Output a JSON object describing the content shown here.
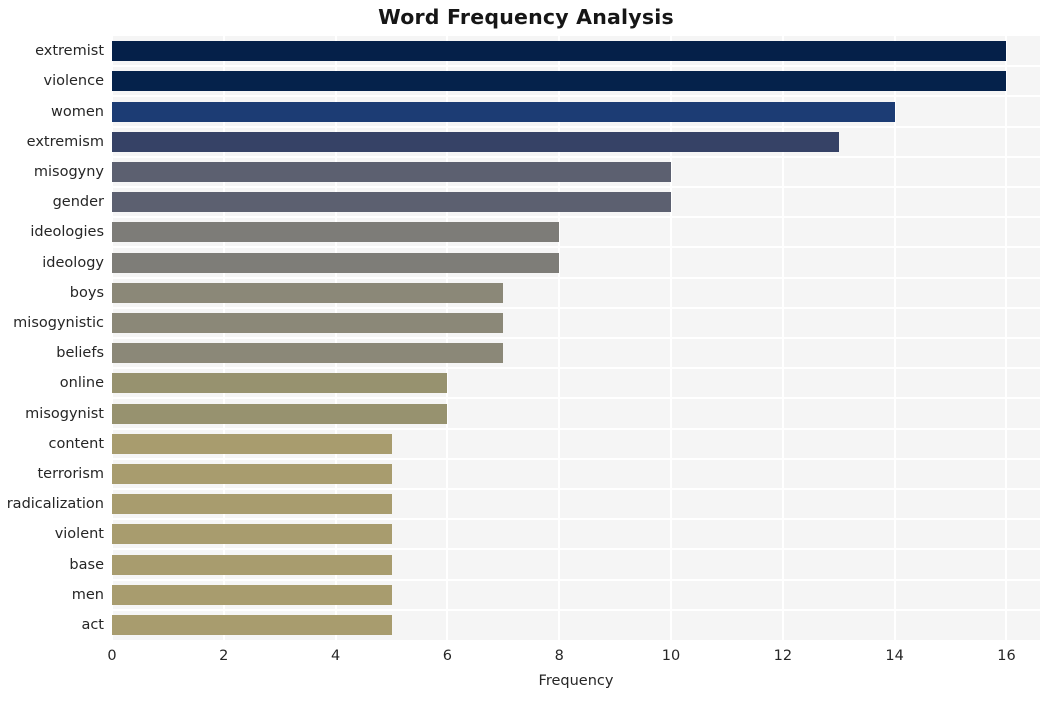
{
  "chart_data": {
    "type": "bar",
    "orientation": "horizontal",
    "title": "Word Frequency Analysis",
    "xlabel": "Frequency",
    "ylabel": "",
    "xlim": [
      0,
      16.6
    ],
    "ylim": [
      0,
      20
    ],
    "grid": true,
    "legend": null,
    "xticks": [
      "0",
      "2",
      "4",
      "6",
      "8",
      "10",
      "12",
      "14",
      "16"
    ],
    "xtick_values": [
      0,
      2,
      4,
      6,
      8,
      10,
      12,
      14,
      16
    ],
    "categories": [
      "extremist",
      "violence",
      "women",
      "extremism",
      "misogyny",
      "gender",
      "ideologies",
      "ideology",
      "boys",
      "misogynistic",
      "beliefs",
      "online",
      "misogynist",
      "content",
      "terrorism",
      "radicalization",
      "violent",
      "base",
      "men",
      "act"
    ],
    "values": [
      16,
      16,
      14,
      13,
      10,
      10,
      8,
      8,
      7,
      7,
      7,
      6,
      6,
      5,
      5,
      5,
      5,
      5,
      5,
      5
    ],
    "bar_colors": [
      "#052049",
      "#05224b",
      "#1c3c74",
      "#364266",
      "#5c6070",
      "#5c6070",
      "#7d7c78",
      "#7e7d78",
      "#8b8878",
      "#8b8878",
      "#8b8878",
      "#97926f",
      "#97926f",
      "#a89c6e",
      "#a89c6e",
      "#a89c6e",
      "#a89c6e",
      "#a89c6e",
      "#a89c6e",
      "#a89c6e"
    ],
    "plot_background": "#f5f5f5",
    "gridline_color": "#ffffff",
    "figure_background": "#ffffff",
    "text_color": "#262626"
  }
}
